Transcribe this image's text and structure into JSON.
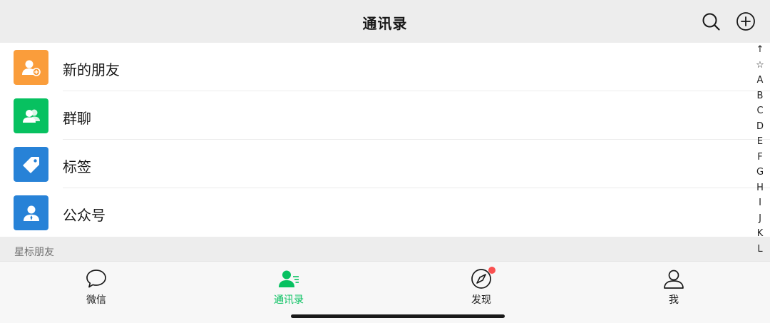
{
  "header": {
    "title": "通讯录",
    "search_icon": "search-icon",
    "add_icon": "add-circle-icon"
  },
  "list": {
    "items": [
      {
        "label": "新的朋友",
        "icon": "add-friend-icon",
        "color": "#fa9d3b"
      },
      {
        "label": "群聊",
        "icon": "group-chat-icon",
        "color": "#07c160"
      },
      {
        "label": "标签",
        "icon": "tag-icon",
        "color": "#2782d7"
      },
      {
        "label": "公众号",
        "icon": "official-account-icon",
        "color": "#2782d7"
      }
    ]
  },
  "section": {
    "starred_title": "星标朋友"
  },
  "index_bar": {
    "items": [
      "↑",
      "☆",
      "A",
      "B",
      "C",
      "D",
      "E",
      "F",
      "G",
      "H",
      "I",
      "J",
      "K",
      "L"
    ]
  },
  "tabbar": {
    "tabs": [
      {
        "label": "微信",
        "icon": "chat-bubble-icon",
        "active": false
      },
      {
        "label": "通讯录",
        "icon": "contacts-icon",
        "active": true
      },
      {
        "label": "发现",
        "icon": "compass-icon",
        "active": false,
        "badge": true
      },
      {
        "label": "我",
        "icon": "person-icon",
        "active": false
      }
    ],
    "active_color": "#07c160",
    "badge_color": "#fa5151"
  }
}
